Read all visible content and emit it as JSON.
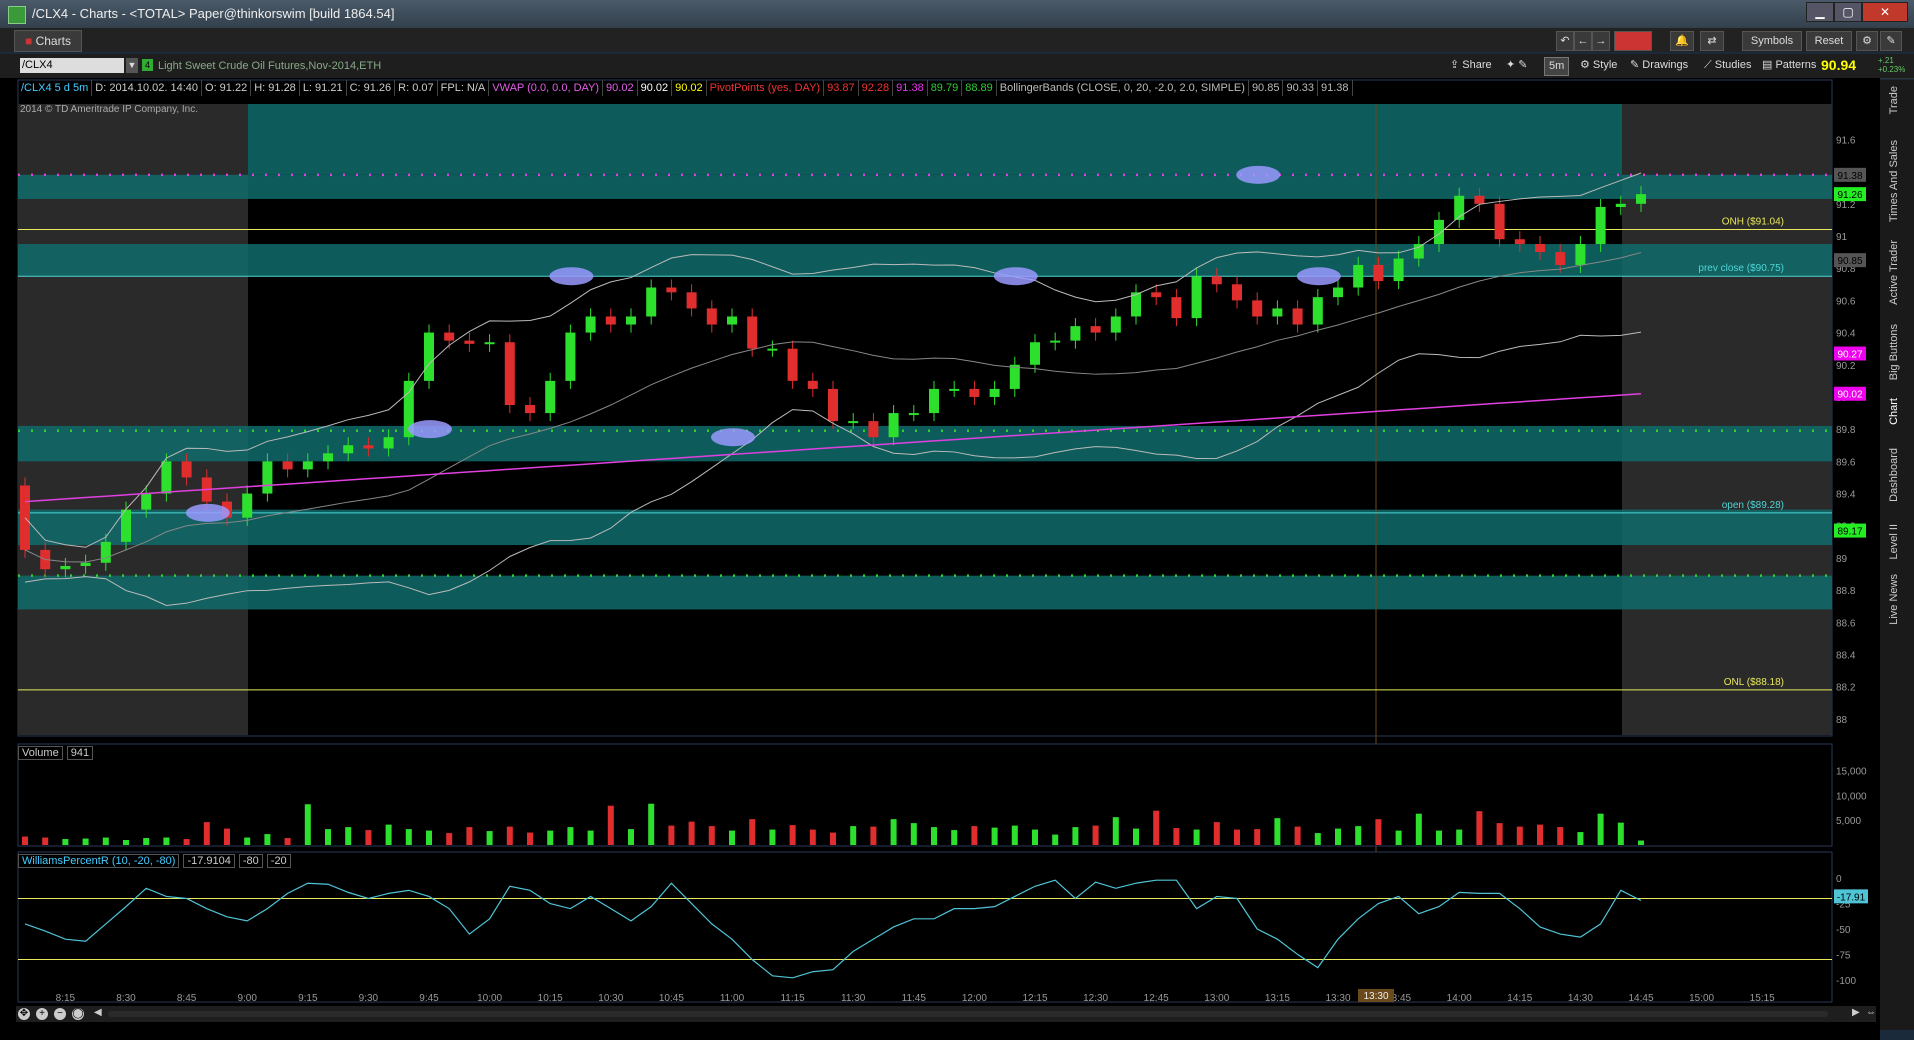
{
  "window": {
    "title": "/CLX4 - Charts - <TOTAL> Paper@thinkorswim [build 1864.54]"
  },
  "tabs": [
    {
      "label": "Charts"
    }
  ],
  "toolbar": {
    "symbols_label": "Symbols",
    "reset_label": "Reset"
  },
  "symbol_bar": {
    "symbol": "/CLX4",
    "description": "Light Sweet Crude Oil Futures,Nov-2014,ETH",
    "share_label": "Share",
    "timeframe": "5m",
    "style_label": "Style",
    "drawings_label": "Drawings",
    "studies_label": "Studies",
    "patterns_label": "Patterns",
    "last_price": "90.94",
    "change": "+.21",
    "change_pct": "+0.23%"
  },
  "info_bar": {
    "symbol_period": "/CLX4 5 d 5m",
    "date": "D: 2014.10.02. 14:40",
    "open": "O: 91.22",
    "high": "H: 91.28",
    "low": "L: 91.21",
    "close": "C: 91.26",
    "range": "R: 0.07",
    "fpl": "FPL: N/A",
    "vwap_label": "VWAP (0.0, 0.0, DAY)",
    "vwap_values": [
      "90.02",
      "90.02",
      "90.02"
    ],
    "pivot_label": "PivotPoints (yes, DAY)",
    "pivot_values": [
      "93.87",
      "92.28",
      "91.38",
      "89.79",
      "88.89"
    ],
    "bb_label": "BollingerBands (CLOSE, 0, 20, -2.0, 2.0, SIMPLE)",
    "bb_values": [
      "90.85",
      "90.33",
      "91.38"
    ]
  },
  "copyright": "2014 © TD Ameritrade IP Company, Inc.",
  "side_tabs": [
    "Trade",
    "Times And Sales",
    "Active Trader",
    "Big Buttons",
    "Chart",
    "Dashboard",
    "Level II",
    "Live News"
  ],
  "volume_panel": {
    "label": "Volume",
    "value": "941"
  },
  "williams_panel": {
    "label": "WilliamsPercentR (10, -20, -80)",
    "values": [
      "-17.9104",
      "-80",
      "-20"
    ]
  },
  "price_labels": [
    {
      "text": "ONH ($91.04)",
      "color": "#e8e85a"
    },
    {
      "text": "prev close ($90.75)",
      "color": "#4fd6d6"
    },
    {
      "text": "open ($89.28)",
      "color": "#4fd6d6"
    },
    {
      "text": "ONL ($88.18)",
      "color": "#e8e85a"
    }
  ],
  "price_badges": [
    "91.38",
    "91.26",
    "90.85",
    "90.27",
    "90.02",
    "89.17"
  ],
  "williams_badge": "-17.91",
  "cursor_time": "13:30",
  "chart_data": [
    {
      "type": "candlestick",
      "title": "",
      "y_ticks": [
        "91.6",
        "91.4",
        "91.2",
        "91",
        "90.8",
        "90.6",
        "90.4",
        "90.2",
        "90",
        "89.8",
        "89.6",
        "89.4",
        "89.2",
        "89",
        "88.8",
        "88.6",
        "88.4",
        "88.2",
        "88"
      ],
      "ylim": [
        87.9,
        91.82
      ],
      "x_ticks": [
        "8:15",
        "8:30",
        "8:45",
        "9:00",
        "9:15",
        "9:30",
        "9:45",
        "10:00",
        "10:15",
        "10:30",
        "10:45",
        "11:00",
        "11:15",
        "11:30",
        "11:45",
        "12:00",
        "12:15",
        "12:30",
        "12:45",
        "13:00",
        "13:15",
        "13:30",
        "13:45",
        "14:00",
        "14:15",
        "14:30",
        "14:45",
        "15:00",
        "15:15"
      ],
      "start_time": "8:05",
      "bar_minutes": 5,
      "closes": [
        89.05,
        88.93,
        88.95,
        88.97,
        89.1,
        89.3,
        89.4,
        89.6,
        89.5,
        89.35,
        89.25,
        89.4,
        89.6,
        89.55,
        89.6,
        89.65,
        89.7,
        89.68,
        89.75,
        90.1,
        90.4,
        90.35,
        90.33,
        90.34,
        89.95,
        89.9,
        90.1,
        90.4,
        90.5,
        90.45,
        90.5,
        90.68,
        90.65,
        90.55,
        90.45,
        90.5,
        90.3,
        90.3,
        90.1,
        90.05,
        89.85,
        89.85,
        89.75,
        89.9,
        89.9,
        90.05,
        90.05,
        90.0,
        90.05,
        90.2,
        90.34,
        90.35,
        90.44,
        90.4,
        90.5,
        90.65,
        90.62,
        90.49,
        90.75,
        90.7,
        90.6,
        90.5,
        90.55,
        90.45,
        90.62,
        90.68,
        90.82,
        90.72,
        90.86,
        90.95,
        91.1,
        91.25,
        91.2,
        90.98,
        90.95,
        90.9,
        90.82,
        90.95,
        91.18,
        91.2,
        91.26
      ],
      "pivot_levels": [
        91.38,
        89.79,
        88.89
      ],
      "onh": 91.04,
      "prev_close": 90.75,
      "open": 89.28,
      "onl": 88.18,
      "vwap_last": 90.02,
      "bb_last": {
        "upper": 91.38,
        "middle": 90.33,
        "lower": 90.85
      }
    },
    {
      "type": "bar",
      "title": "Volume",
      "y_ticks": [
        "15,000",
        "10,000",
        "5,000"
      ],
      "ylim": [
        0,
        17500
      ],
      "values": [
        1700,
        1500,
        1200,
        1300,
        1500,
        1000,
        1400,
        1500,
        1200,
        4600,
        3300,
        1500,
        2200,
        1400,
        8200,
        3200,
        3600,
        3000,
        4100,
        3200,
        2900,
        2400,
        3600,
        2800,
        3700,
        2500,
        2900,
        3600,
        2900,
        7900,
        3200,
        8300,
        3900,
        4700,
        3800,
        2900,
        5200,
        3100,
        4000,
        3100,
        2500,
        3800,
        3700,
        5200,
        4400,
        3600,
        3000,
        3800,
        3500,
        3900,
        3100,
        2100,
        3600,
        3900,
        5600,
        3300,
        6900,
        3400,
        3100,
        4600,
        3100,
        3200,
        5400,
        3700,
        2400,
        3300,
        3800,
        5200,
        2900,
        6300,
        2900,
        3100,
        6800,
        4400,
        3700,
        4100,
        3600,
        2600,
        6300,
        4500,
        900
      ]
    },
    {
      "type": "line",
      "title": "WilliamsPercentR",
      "y_ticks": [
        "0",
        "-25",
        "-50",
        "-75",
        "-100"
      ],
      "ylim": [
        -108,
        8
      ],
      "levels": [
        -20,
        -80
      ],
      "values": [
        -45,
        -52,
        -60,
        -62,
        -45,
        -28,
        -10,
        -18,
        -20,
        -30,
        -38,
        -42,
        -30,
        -15,
        -5,
        -6,
        -14,
        -20,
        -15,
        -12,
        -18,
        -30,
        -55,
        -40,
        -8,
        -12,
        -25,
        -30,
        -18,
        -30,
        -42,
        -28,
        -5,
        -25,
        -45,
        -60,
        -80,
        -96,
        -98,
        -92,
        -90,
        -72,
        -60,
        -48,
        -40,
        -40,
        -30,
        -30,
        -28,
        -18,
        -8,
        -2,
        -20,
        -4,
        -10,
        -5,
        -2,
        -2,
        -30,
        -18,
        -20,
        -50,
        -60,
        -75,
        -88,
        -60,
        -40,
        -25,
        -18,
        -35,
        -28,
        -14,
        -15,
        -15,
        -30,
        -48,
        -55,
        -58,
        -45,
        -12,
        -22
      ]
    }
  ]
}
